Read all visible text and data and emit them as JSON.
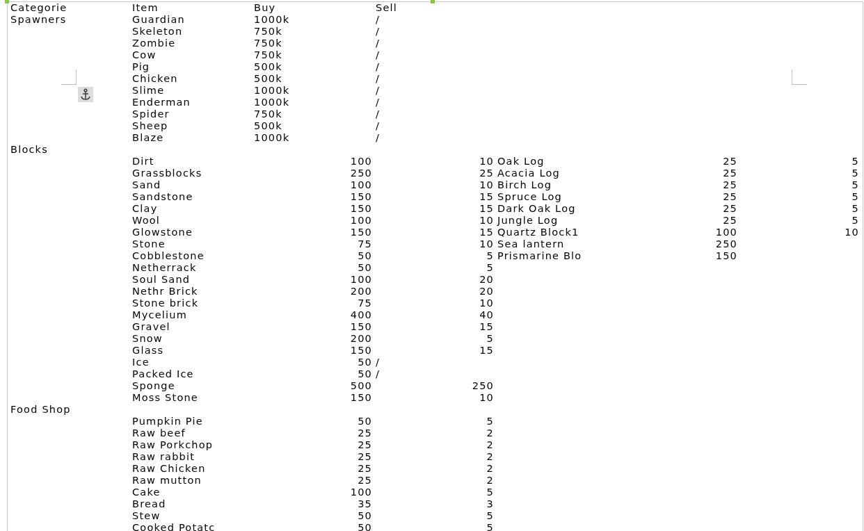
{
  "columns": [
    "Categorie",
    "Item",
    "Buy",
    "Sell"
  ],
  "rows": [
    {
      "category": "Spawners",
      "item": "Guardian",
      "buy": "1000k",
      "sell": "/"
    },
    {
      "item": "Skeleton",
      "buy": "750k",
      "sell": "/"
    },
    {
      "item": "Zombie",
      "buy": "750k",
      "sell": "/"
    },
    {
      "item": "Cow",
      "buy": "750k",
      "sell": "/"
    },
    {
      "item": "Pig",
      "buy": "500k",
      "sell": "/"
    },
    {
      "item": "Chicken",
      "buy": "500k",
      "sell": "/"
    },
    {
      "item": "Slime",
      "buy": "1000k",
      "sell": "/"
    },
    {
      "item": "Enderman",
      "buy": "1000k",
      "sell": "/"
    },
    {
      "item": "Spider",
      "buy": "750k",
      "sell": "/"
    },
    {
      "item": "Sheep",
      "buy": "500k",
      "sell": "/"
    },
    {
      "item": "Blaze",
      "buy": "1000k",
      "sell": "/"
    },
    {
      "category": "Blocks"
    },
    {
      "item": "Dirt",
      "buy": "100",
      "sell": "10",
      "item_2": "Oak Log",
      "buy_2": "25",
      "sell_2": "5"
    },
    {
      "item": "Grassblocks",
      "buy": "250",
      "sell": "25",
      "item_2": "Acacia Log",
      "buy_2": "25",
      "sell_2": "5"
    },
    {
      "item": "Sand",
      "buy": "100",
      "sell": "10",
      "item_2": "Birch Log",
      "buy_2": "25",
      "sell_2": "5"
    },
    {
      "item": "Sandstone",
      "buy": "150",
      "sell": "15",
      "item_2": "Spruce Log",
      "buy_2": "25",
      "sell_2": "5"
    },
    {
      "item": "Clay",
      "buy": "150",
      "sell": "15",
      "item_2": "Dark Oak Log",
      "buy_2": "25",
      "sell_2": "5"
    },
    {
      "item": "Wool",
      "buy": "100",
      "sell": "10",
      "item_2": "Jungle Log",
      "buy_2": "25",
      "sell_2": "5"
    },
    {
      "item": "Glowstone",
      "buy": "150",
      "sell": "15",
      "item_2": "Quartz Block1",
      "buy_2": "100",
      "sell_2": "10"
    },
    {
      "item": "Stone",
      "buy": "75",
      "sell": "10",
      "item_2": "Sea lantern",
      "buy_2": "250"
    },
    {
      "item": "Cobblestone",
      "buy": "50",
      "sell": "5",
      "item_2": "Prismarine Blo",
      "buy_2": "150"
    },
    {
      "item": "Netherrack",
      "buy": "50",
      "sell": "5"
    },
    {
      "item": "Soul Sand",
      "buy": "100",
      "sell": "20"
    },
    {
      "item": "Nethr Brick",
      "buy": "200",
      "sell": "20"
    },
    {
      "item": "Stone brick",
      "buy": "75",
      "sell": "10"
    },
    {
      "item": "Mycelium",
      "buy": "400",
      "sell": "40"
    },
    {
      "item": "Gravel",
      "buy": "150",
      "sell": "15"
    },
    {
      "item": "Snow",
      "buy": "200",
      "sell": "5"
    },
    {
      "item": "Glass",
      "buy": "150",
      "sell": "15"
    },
    {
      "item": "Ice",
      "buy": "50",
      "sell": "/"
    },
    {
      "item": "Packed Ice",
      "buy": "50",
      "sell": "/"
    },
    {
      "item": "Sponge",
      "buy": "500",
      "sell": "250"
    },
    {
      "item": "Moss Stone",
      "buy": "150",
      "sell": "10"
    },
    {
      "category": "Food Shop"
    },
    {
      "item": "Pumpkin Pie",
      "buy": "50",
      "sell": "5"
    },
    {
      "item": "Raw beef",
      "buy": "25",
      "sell": "2"
    },
    {
      "item": "Raw Porkchop",
      "buy": "25",
      "sell": "2"
    },
    {
      "item": "Raw rabbit",
      "buy": "25",
      "sell": "2"
    },
    {
      "item": "Raw Chicken",
      "buy": "25",
      "sell": "2"
    },
    {
      "item": "Raw mutton",
      "buy": "25",
      "sell": "2"
    },
    {
      "item": "Cake",
      "buy": "100",
      "sell": "5"
    },
    {
      "item": "Bread",
      "buy": "35",
      "sell": "3"
    },
    {
      "item": "Stew",
      "buy": "50",
      "sell": "5"
    },
    {
      "item": "Cooked Potatc",
      "buy": "50",
      "sell": "5"
    }
  ]
}
